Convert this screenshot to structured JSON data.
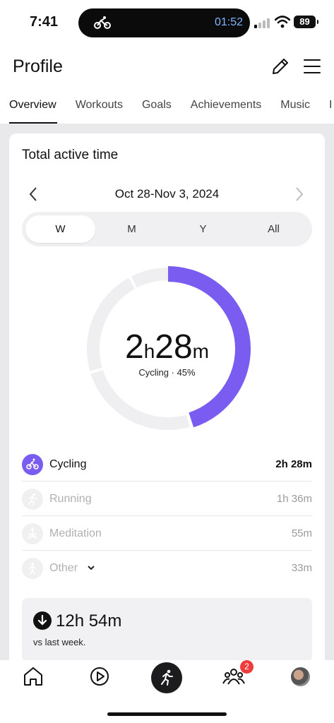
{
  "status_bar": {
    "time": "7:41",
    "activity_timer": "01:52",
    "battery": "89"
  },
  "header": {
    "title": "Profile"
  },
  "tabs": [
    {
      "label": "Overview"
    },
    {
      "label": "Workouts"
    },
    {
      "label": "Goals"
    },
    {
      "label": "Achievements"
    },
    {
      "label": "Music"
    },
    {
      "label": "I"
    }
  ],
  "card": {
    "title": "Total active time",
    "date_range": "Oct 28-Nov 3, 2024",
    "periods": [
      "W",
      "M",
      "Y",
      "All"
    ],
    "selected_period": "W",
    "total": {
      "hours": "2",
      "hours_unit": "h",
      "minutes": "28",
      "minutes_unit": "m"
    },
    "subtitle": "Cycling · 45%",
    "donut_fraction": 0.45,
    "activities": [
      {
        "name": "Cycling",
        "value": "2h 28m"
      },
      {
        "name": "Running",
        "value": "1h 36m"
      },
      {
        "name": "Meditation",
        "value": "55m"
      },
      {
        "name": "Other",
        "value": "33m"
      }
    ],
    "comparison": {
      "value": "12h 54m",
      "label": "vs last week."
    }
  },
  "nav": {
    "community_badge": "2"
  },
  "colors": {
    "accent": "#7b5cf0",
    "track": "#efeff1",
    "badge": "#ee3b3b"
  }
}
